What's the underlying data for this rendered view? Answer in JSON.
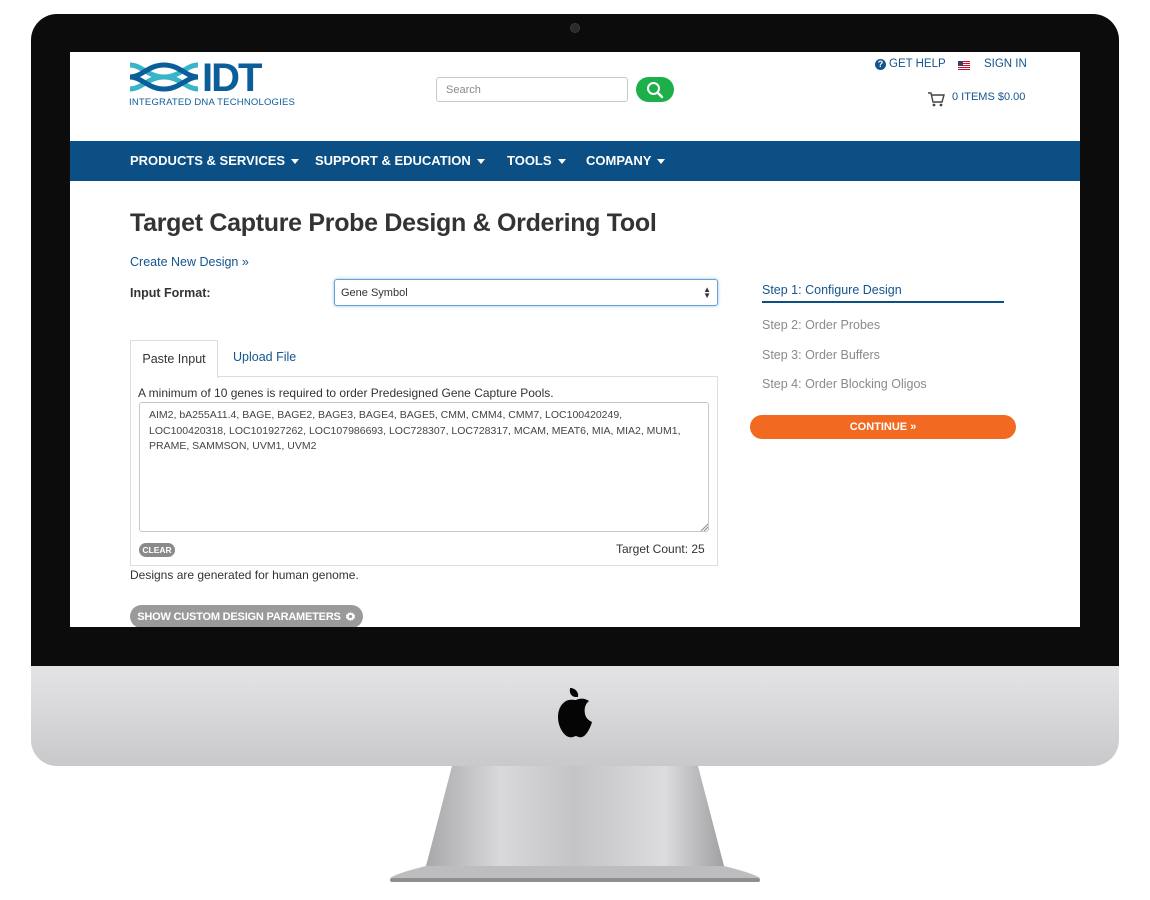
{
  "header": {
    "logo_wordmark": "IDT",
    "logo_tagline": "INTEGRATED DNA TECHNOLOGIES",
    "search_placeholder": "Search",
    "get_help": "GET HELP",
    "sign_in": "SIGN IN",
    "cart": "0 ITEMS $0.00"
  },
  "nav": {
    "items": [
      {
        "label": "PRODUCTS & SERVICES"
      },
      {
        "label": "SUPPORT & EDUCATION"
      },
      {
        "label": "TOOLS"
      },
      {
        "label": "COMPANY"
      }
    ]
  },
  "page": {
    "title": "Target Capture Probe Design & Ordering Tool",
    "create_link": "Create New Design »",
    "input_format_label": "Input Format:",
    "input_format_value": "Gene Symbol",
    "tabs": [
      {
        "label": "Paste Input",
        "active": true
      },
      {
        "label": "Upload File",
        "active": false
      }
    ],
    "min_note": "A minimum of 10 genes is required to order Predesigned Gene Capture Pools.",
    "genes": "AIM2, bA255A11.4, BAGE, BAGE2, BAGE3, BAGE4, BAGE5, CMM, CMM4, CMM7, LOC100420249, LOC100420318, LOC101927262, LOC107986693, LOC728307, LOC728317, MCAM, MEAT6, MIA, MIA2, MUM1, PRAME, SAMMSON, UVM1, UVM2",
    "clear_label": "CLEAR",
    "target_count": "Target Count: 25",
    "human_note": "Designs are generated for human genome.",
    "custom_params_label": "SHOW CUSTOM DESIGN PARAMETERS"
  },
  "steps": {
    "items": [
      {
        "label": "Step 1: Configure Design",
        "active": true
      },
      {
        "label": "Step 2: Order Probes",
        "active": false
      },
      {
        "label": "Step 3: Order Buffers",
        "active": false
      },
      {
        "label": "Step 4: Order Blocking Oligos",
        "active": false
      }
    ],
    "continue_label": "CONTINUE »"
  },
  "colors": {
    "brand_blue": "#0b4f84",
    "link_blue": "#14558f",
    "search_green": "#1db04a",
    "continue_orange": "#f26a21"
  },
  "icons": [
    "search-icon",
    "help-icon",
    "us-flag-icon",
    "cart-icon",
    "caret-down-icon",
    "gear-icon",
    "apple-logo-icon"
  ]
}
